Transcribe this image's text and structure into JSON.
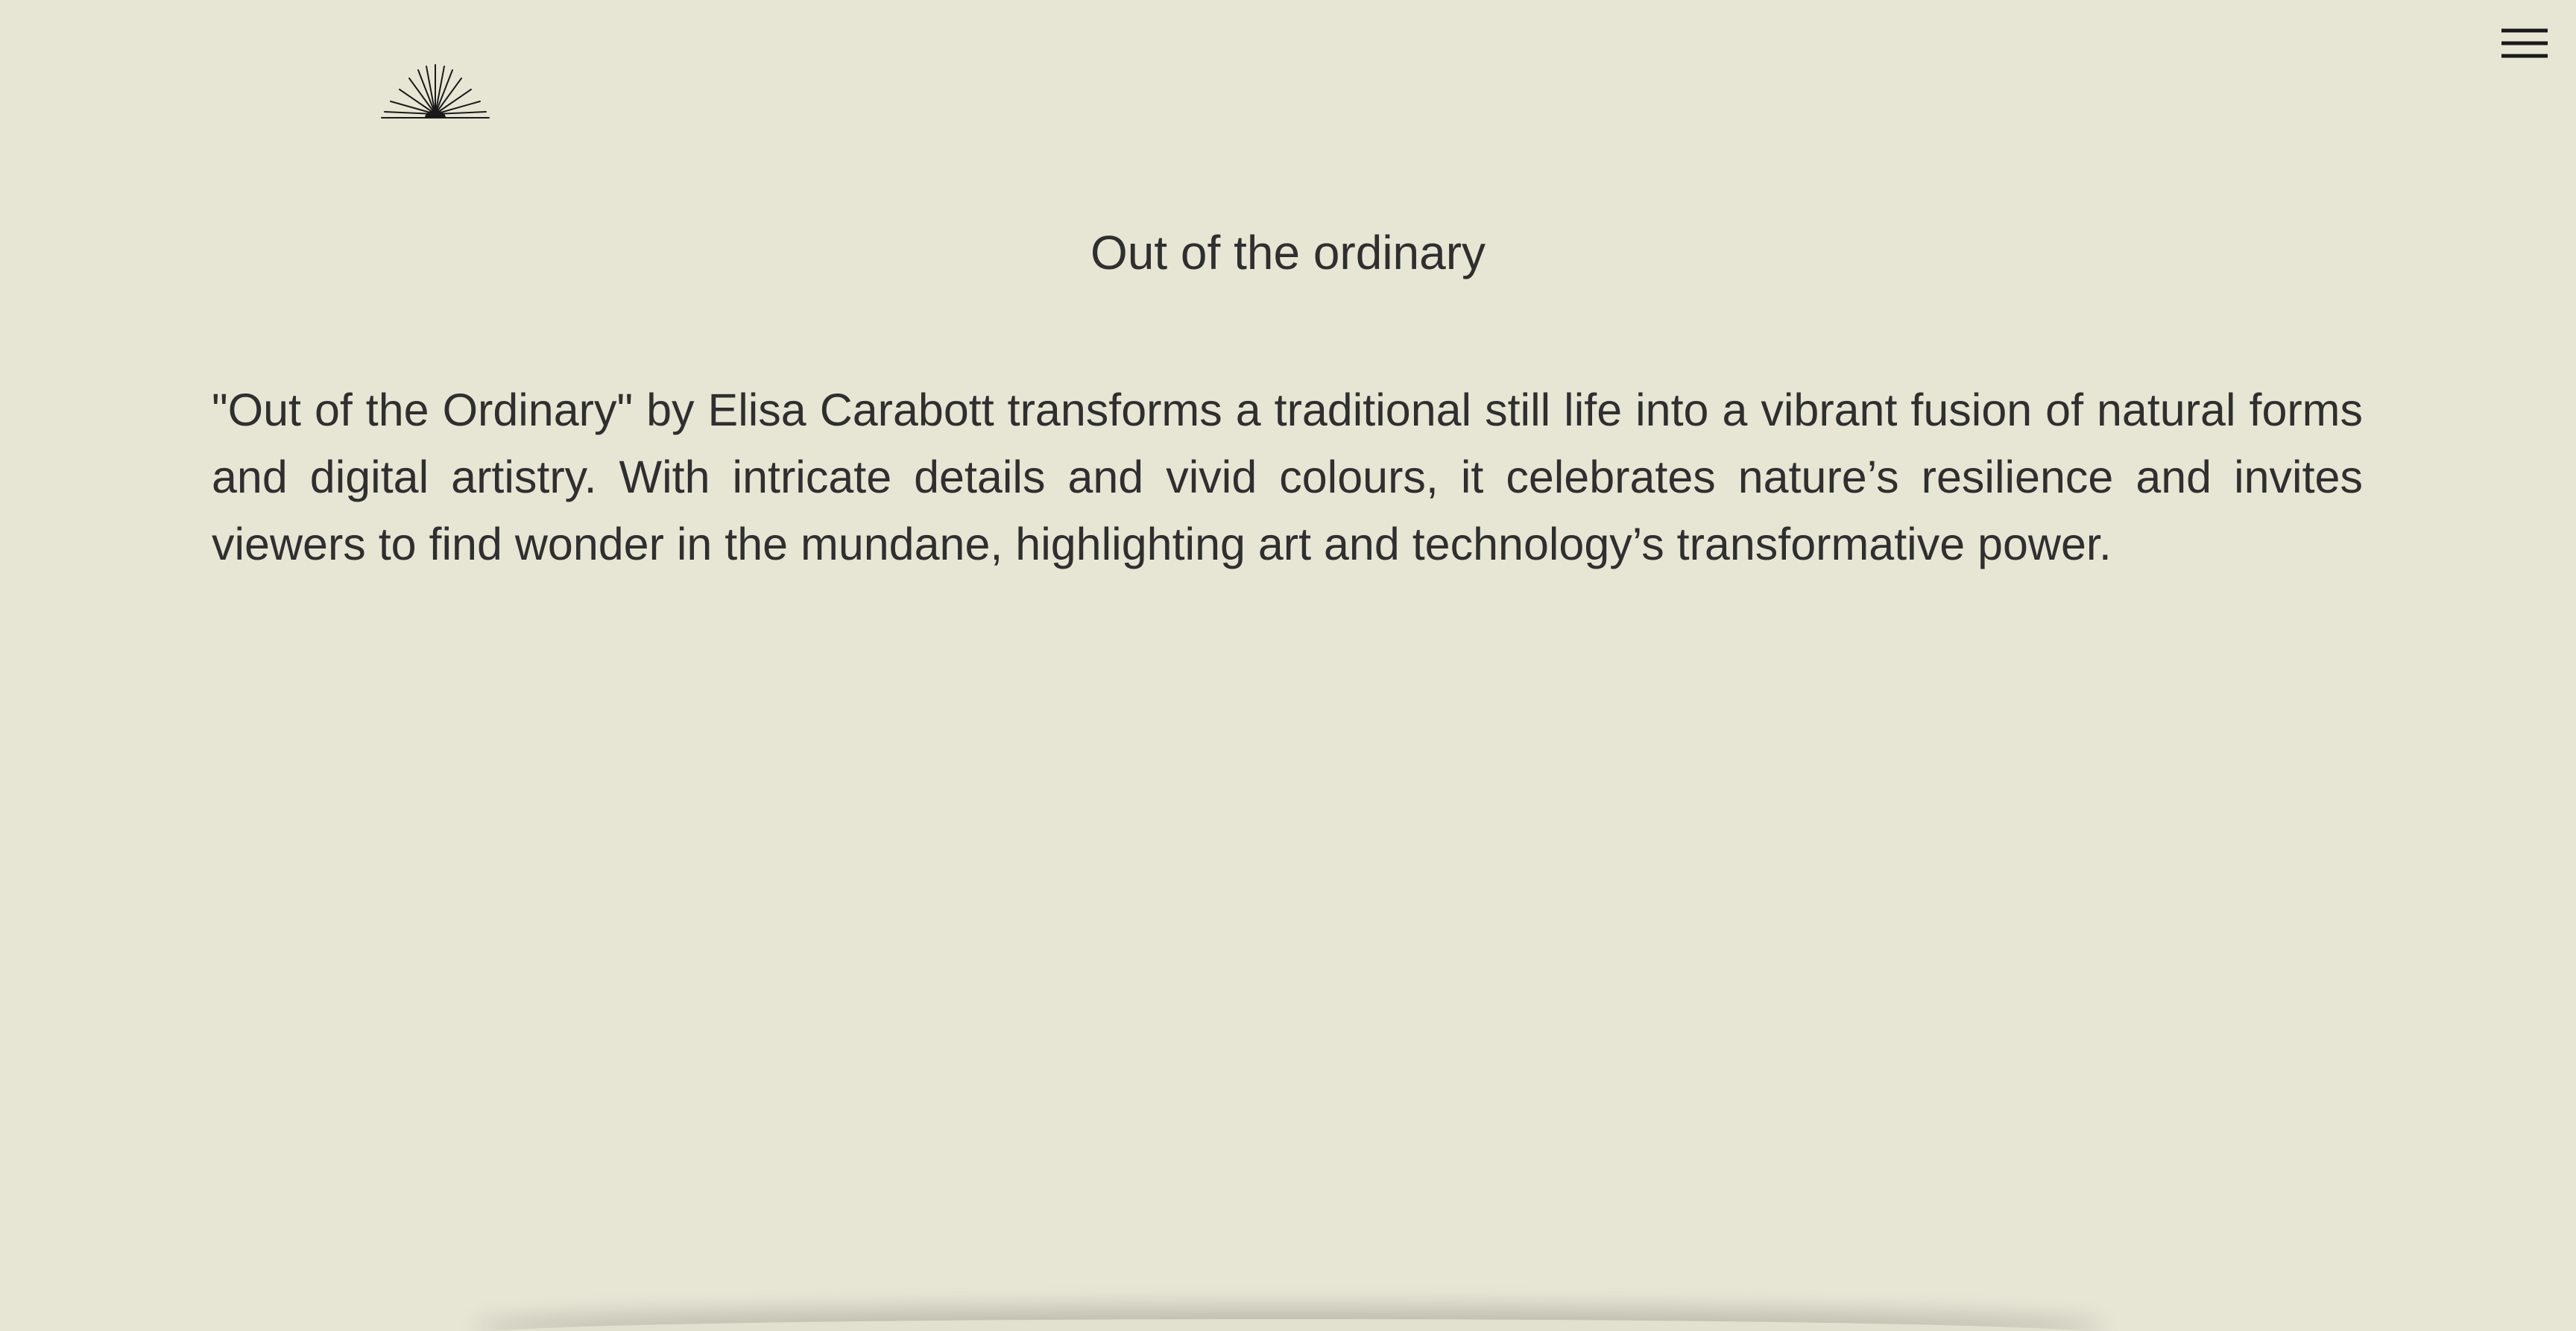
{
  "header": {
    "logo_icon": "sunburst-logo-icon",
    "menu_icon": "hamburger-menu-icon"
  },
  "main": {
    "title": "Out of the ordinary",
    "description": "\"Out of the Ordinary\" by Elisa Carabott transforms a traditional still life into a vibrant fusion of natural forms and digital artistry. With intricate details and vivid colours, it celebrates nature’s resilience and invites viewers to find wonder in the mundane, highlighting art and technology’s transformative power."
  },
  "colors": {
    "background": "#e7e6d5",
    "text": "#2f2f2f",
    "icon": "#1a1a1a"
  }
}
